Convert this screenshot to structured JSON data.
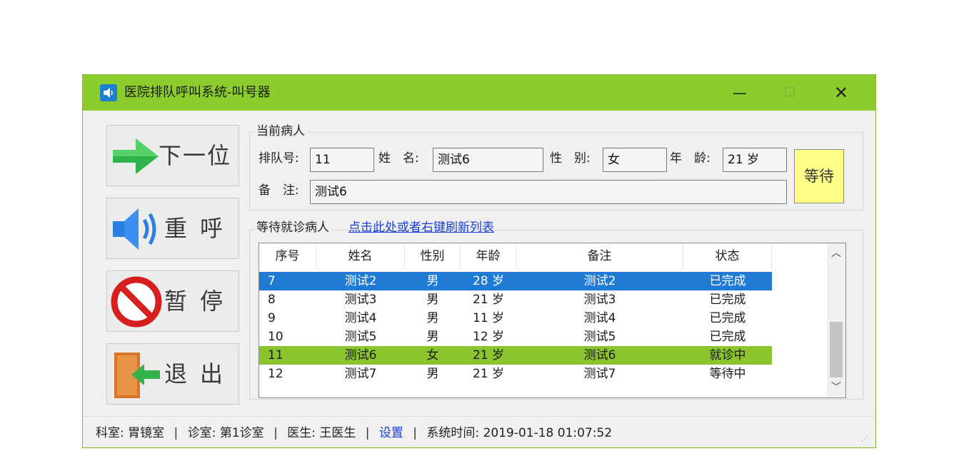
{
  "window": {
    "title": "医院排队呼叫系统-叫号器",
    "minimize_label": "—",
    "maximize_label": "☐",
    "close_label": "✕"
  },
  "sidebar": {
    "next": "下一位",
    "recall": "重呼",
    "pause": "暂停",
    "exit": "退出"
  },
  "current": {
    "group_title": "当前病人",
    "queue_label": "排队号:",
    "queue_value": "11",
    "name_label": "姓　名:",
    "name_value": "测试6",
    "gender_label": "性　别:",
    "gender_value": "女",
    "age_label": "年　龄:",
    "age_value": "21 岁",
    "note_label": "备　注:",
    "note_value": "测试6",
    "wait_button": "等待"
  },
  "waiting": {
    "group_title": "等待就诊病人",
    "refresh_link": "点击此处或者右键刷新列表",
    "columns": [
      "序号",
      "姓名",
      "性别",
      "年龄",
      "备注",
      "状态"
    ],
    "rows": [
      {
        "idx": "7",
        "name": "测试2",
        "gender": "男",
        "age": "28 岁",
        "note": "测试2",
        "status": "已完成"
      },
      {
        "idx": "8",
        "name": "测试3",
        "gender": "男",
        "age": "21 岁",
        "note": "测试3",
        "status": "已完成"
      },
      {
        "idx": "9",
        "name": "测试4",
        "gender": "男",
        "age": "11 岁",
        "note": "测试4",
        "status": "已完成"
      },
      {
        "idx": "10",
        "name": "测试5",
        "gender": "男",
        "age": "12 岁",
        "note": "测试5",
        "status": "已完成"
      },
      {
        "idx": "11",
        "name": "测试6",
        "gender": "女",
        "age": "21 岁",
        "note": "测试6",
        "status": "就诊中"
      },
      {
        "idx": "12",
        "name": "测试7",
        "gender": "男",
        "age": "21 岁",
        "note": "测试7",
        "status": "等待中"
      }
    ]
  },
  "status": {
    "dept_label": "科室:",
    "dept_value": "胃镜室",
    "room_label": "诊室:",
    "room_value": "第1诊室",
    "doctor_label": "医生:",
    "doctor_value": "王医生",
    "settings": "设置",
    "time_label": "系统时间:",
    "time_value": "2019-01-18 01:07:52"
  },
  "colors": {
    "titlebar": "#8ccd2e",
    "selected_row": "#1f7ad4",
    "active_row": "#8cc42e",
    "wait_button": "#ffff88",
    "link": "#1a3fd6"
  }
}
